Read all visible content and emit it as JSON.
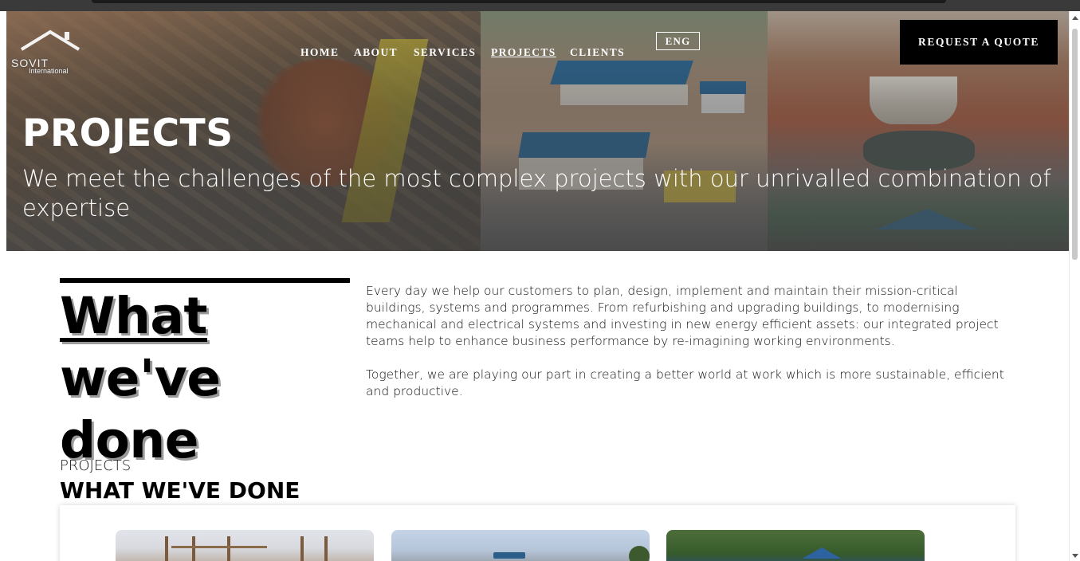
{
  "brand": {
    "name": "SOVIT",
    "subtitle": "International"
  },
  "nav": {
    "items": [
      {
        "label": "HOME",
        "active": false
      },
      {
        "label": "ABOUT",
        "active": false
      },
      {
        "label": "SERVICES",
        "active": false
      },
      {
        "label": "PROJECTS",
        "active": true
      },
      {
        "label": "CLIENTS",
        "active": false
      }
    ],
    "language": "ENG",
    "cta_label": "REQUEST A QUOTE"
  },
  "hero": {
    "title": "PROJECTS",
    "subtitle": "We meet the challenges of the most complex projects with our unrivalled combination of expertise"
  },
  "intro": {
    "heading_part1": "What",
    "heading_part2": " we've done",
    "paragraphs": [
      "Every day we help our customers to plan, design, implement and maintain their mission-critical buildings, systems and programmes. From refurbishing and upgrading buildings, to modernising mechanical and electrical systems and investing in new energy efficient assets: our integrated project teams help to enhance business performance by re-imagining working environments.",
      "Together, we are playing our part in creating a better world at work which is more sustainable, efficient and productive."
    ]
  },
  "projects_section": {
    "eyebrow": "PROJECTS",
    "title": "WHAT WE'VE DONE"
  },
  "colors": {
    "cta_background": "#000000",
    "nav_text": "#ffffff",
    "roof_blue": "#2e6c9c"
  }
}
